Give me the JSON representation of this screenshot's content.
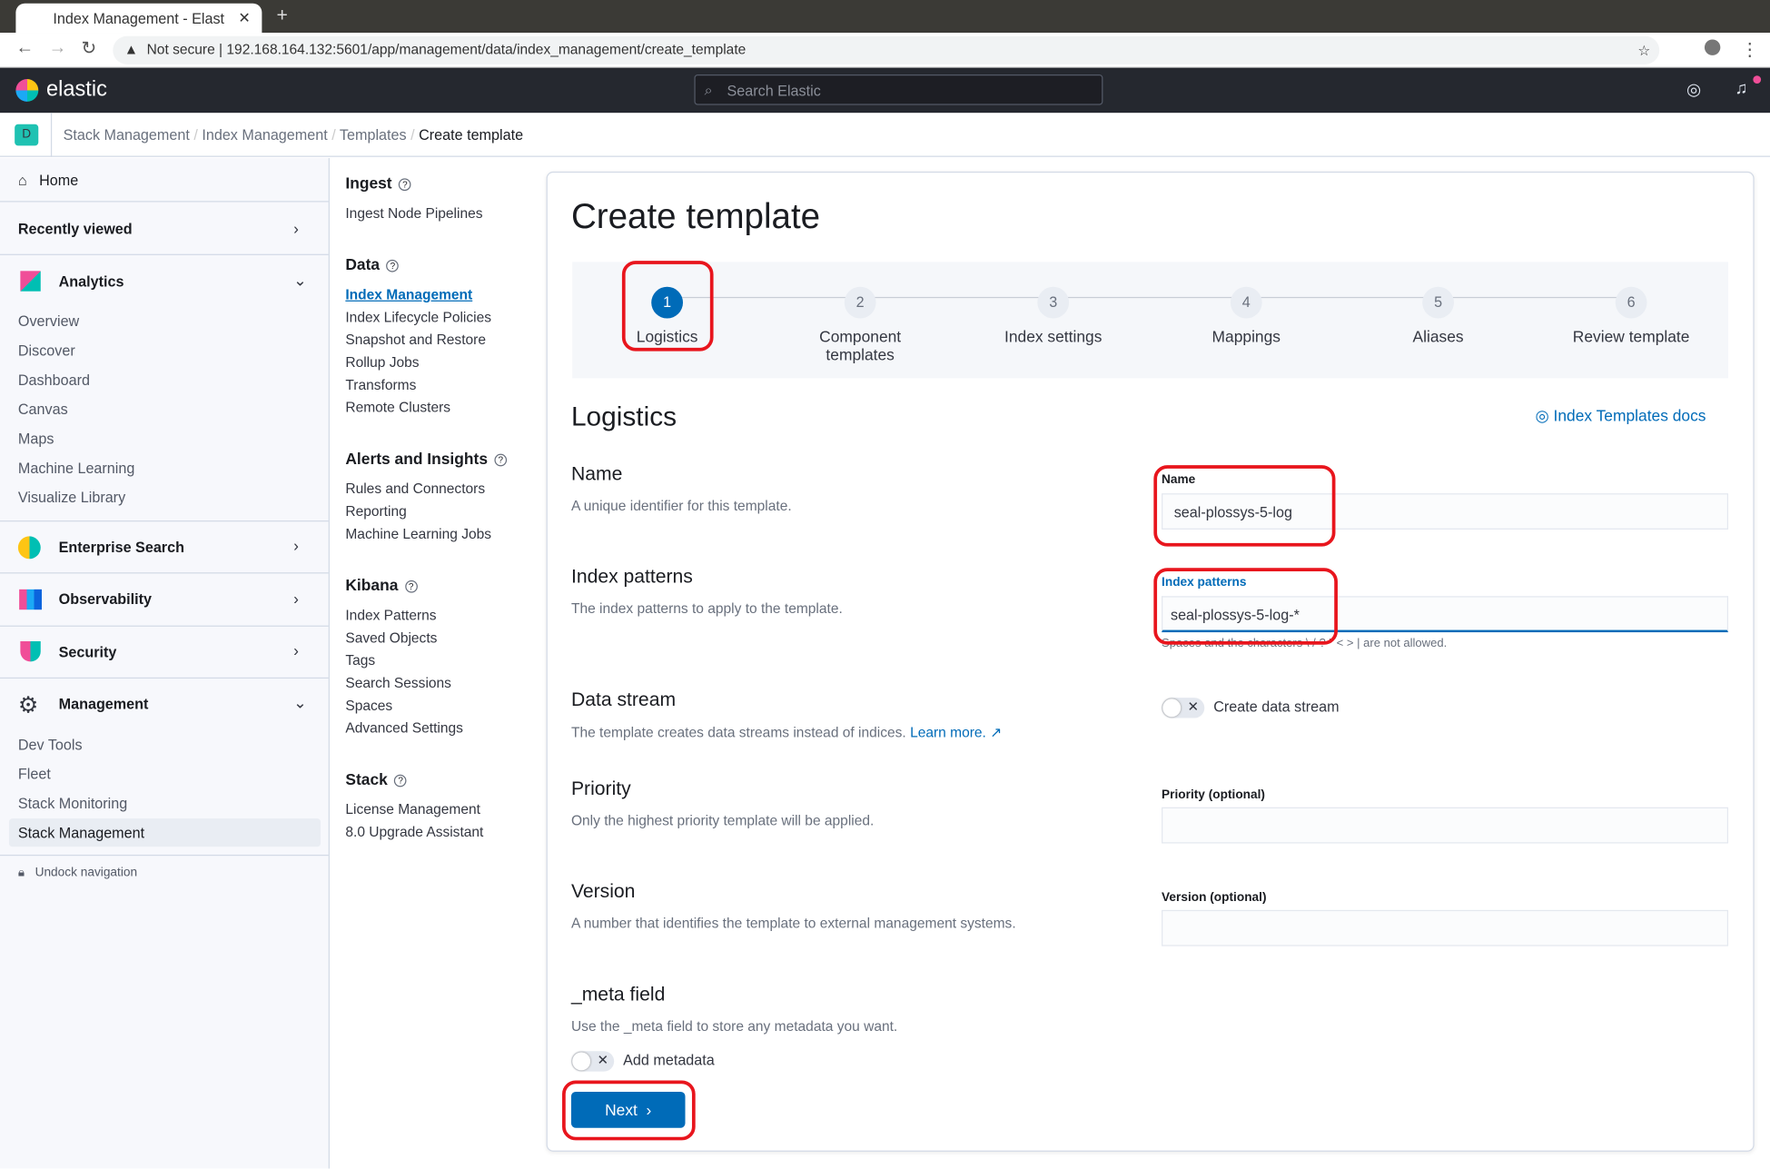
{
  "browser": {
    "tab_title": "Index Management - Elast",
    "url": "192.168.164.132:5601/app/management/data/index_management/create_template",
    "security": "Not secure"
  },
  "header": {
    "brand": "elastic",
    "search_placeholder": "Search Elastic"
  },
  "breadcrumbs": {
    "space": "D",
    "items": [
      "Stack Management",
      "Index Management",
      "Templates",
      "Create template"
    ]
  },
  "sidebar": {
    "home": "Home",
    "recently_viewed": "Recently viewed",
    "analytics": {
      "label": "Analytics",
      "items": [
        "Overview",
        "Discover",
        "Dashboard",
        "Canvas",
        "Maps",
        "Machine Learning",
        "Visualize Library"
      ]
    },
    "enterprise_search": "Enterprise Search",
    "observability": "Observability",
    "security": "Security",
    "management": {
      "label": "Management",
      "items": [
        "Dev Tools",
        "Fleet",
        "Stack Monitoring",
        "Stack Management"
      ]
    },
    "undock": "Undock navigation"
  },
  "mgmt_nav": [
    {
      "title": "Ingest",
      "items": [
        "Ingest Node Pipelines"
      ]
    },
    {
      "title": "Data",
      "items": [
        "Index Management",
        "Index Lifecycle Policies",
        "Snapshot and Restore",
        "Rollup Jobs",
        "Transforms",
        "Remote Clusters"
      ]
    },
    {
      "title": "Alerts and Insights",
      "items": [
        "Rules and Connectors",
        "Reporting",
        "Machine Learning Jobs"
      ]
    },
    {
      "title": "Kibana",
      "items": [
        "Index Patterns",
        "Saved Objects",
        "Tags",
        "Search Sessions",
        "Spaces",
        "Advanced Settings"
      ]
    },
    {
      "title": "Stack",
      "items": [
        "License Management",
        "8.0 Upgrade Assistant"
      ]
    }
  ],
  "page": {
    "title": "Create template",
    "steps": [
      {
        "n": "1",
        "label": "Logistics"
      },
      {
        "n": "2",
        "label": "Component templates"
      },
      {
        "n": "3",
        "label": "Index settings"
      },
      {
        "n": "4",
        "label": "Mappings"
      },
      {
        "n": "5",
        "label": "Aliases"
      },
      {
        "n": "6",
        "label": "Review template"
      }
    ],
    "section": "Logistics",
    "docs_link": "Index Templates docs",
    "name": {
      "title": "Name",
      "desc": "A unique identifier for this template.",
      "label": "Name",
      "value": "seal-plossys-5-log"
    },
    "patterns": {
      "title": "Index patterns",
      "desc": "The index patterns to apply to the template.",
      "label": "Index patterns",
      "value": "seal-plossys-5-log-*",
      "help": "Spaces and the characters \\ / ? \" < > | are not allowed."
    },
    "datastream": {
      "title": "Data stream",
      "desc": "The template creates data streams instead of indices.",
      "learn": "Learn more.",
      "toggle": "Create data stream"
    },
    "priority": {
      "title": "Priority",
      "desc": "Only the highest priority template will be applied.",
      "label": "Priority (optional)"
    },
    "version": {
      "title": "Version",
      "desc": "A number that identifies the template to external management systems.",
      "label": "Version (optional)"
    },
    "meta": {
      "title": "_meta field",
      "desc": "Use the _meta field to store any metadata you want.",
      "toggle": "Add metadata"
    },
    "next": "Next"
  }
}
